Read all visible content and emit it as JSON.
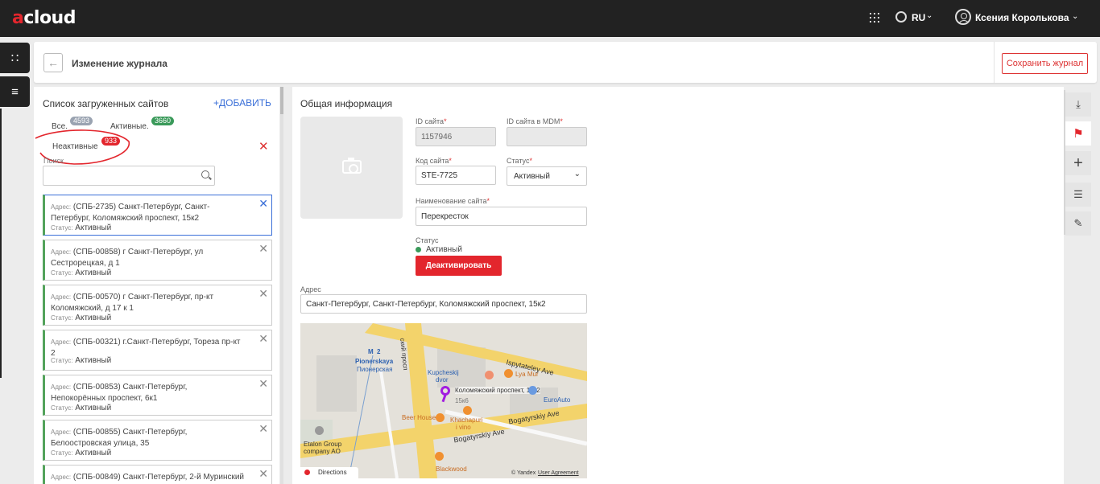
{
  "topbar": {
    "logo_a": "a",
    "logo_rest": "cloud",
    "lang": "RU",
    "lang_chevron": "⌄",
    "user_name": "Ксения Королькова",
    "user_chevron": "⌄",
    "icons": [
      "apps-grid-icon",
      "globe-icon",
      "user-icon"
    ]
  },
  "rail": {
    "apps_icon": "∷",
    "menu_icon": "≡"
  },
  "header": {
    "back_icon": "←",
    "title": "Изменение журнала",
    "save_label": "Сохранить журнал"
  },
  "sites": {
    "title": "Список загруженных сайтов",
    "add_label": "+ДОБАВИТЬ",
    "tabs": [
      {
        "label": "Все.",
        "count": "4593",
        "color": "#9aa3b1"
      },
      {
        "label": "Активные.",
        "count": "3660",
        "color": "#3a9a5a"
      },
      {
        "label": "Неактивные",
        "count": "933",
        "color": "#e3262d"
      }
    ],
    "clear_icon": "✕",
    "search_label": "Поиск",
    "search_value": "",
    "address_label": "Адрес:",
    "status_label": "Статус:",
    "items": [
      {
        "address": "(СПБ-2735) Санкт-Петербург, Санкт-Петербург, Коломяжский проспект, 15к2",
        "status": "Активный"
      },
      {
        "address": "(СПБ-00858) г Санкт-Петербург, ул Сестрорецкая, д 1",
        "status": "Активный"
      },
      {
        "address": "(СПБ-00570) г Санкт-Петербург, пр-кт Коломяжский, д 17 к 1",
        "status": "Активный"
      },
      {
        "address": "(СПБ-00321) г.Санкт-Петербург, Тореза пр-кт 2",
        "status": "Активный"
      },
      {
        "address": "(СПБ-00853) Санкт-Петербург, Непокорённых проспект, 6к1",
        "status": "Активный"
      },
      {
        "address": "(СПБ-00855) Санкт-Петербург, Белоостровская улица, 35",
        "status": "Активный"
      },
      {
        "address": "(СПБ-00849) Санкт-Петербург, 2-й Муринский",
        "status": ""
      }
    ]
  },
  "info": {
    "title": "Общая информация",
    "site_id_label": "ID сайта",
    "site_id": "1157946",
    "mdm_id_label": "ID сайта в MDM",
    "mdm_id": "",
    "code_label": "Код сайта",
    "code": "STE-7725",
    "status_label": "Статус",
    "status_value": "Активный",
    "name_label": "Наименование сайта",
    "name": "Перекресток",
    "req": "*",
    "state_label": "Статус",
    "state_value": "Активный",
    "deactivate_label": "Деактивировать",
    "address_label": "Адрес",
    "address": "Санкт-Петербург, Санкт-Петербург, Коломяжский проспект, 15к2",
    "select_chevron": "⌄"
  },
  "map": {
    "pin_label": "Коломяжский проспект, 15к2",
    "metro_en": "Pionerskaya",
    "metro_ru": "Пионерская",
    "street1": "Ispytateley Ave",
    "street2": "Bogatyrskiy Ave",
    "street2b": "Bogatyrskiy Ave",
    "street3": "ский просп",
    "kupcheskij_1": "Kupcheskij",
    "kupcheskij_2": "dvor",
    "lya_mur": "Lya Mur",
    "euroauto": "EuroAuto",
    "beer_house": "Beer House",
    "khachapuri_1": "Khachapuri",
    "khachapuri_2": "i vino",
    "etalon_1": "Etalon Group",
    "etalon_2": "company AO",
    "blackwood": "Blackwood",
    "directions": "Directions",
    "yandex": "© Yandex",
    "agreement": "User Agreement",
    "house_15k6": "15к6",
    "metro_m": "M",
    "metro_2": "2"
  },
  "right_rail": {
    "download_icon": "⤓",
    "flag_icon": "⚑",
    "add_icon": "+",
    "list_icon": "☰",
    "edit_list_icon": "✎"
  },
  "colors": {
    "accent_red": "#e3262d",
    "link_blue": "#3a6fd8",
    "status_green": "#3a9a5a",
    "topbar": "#222222"
  }
}
